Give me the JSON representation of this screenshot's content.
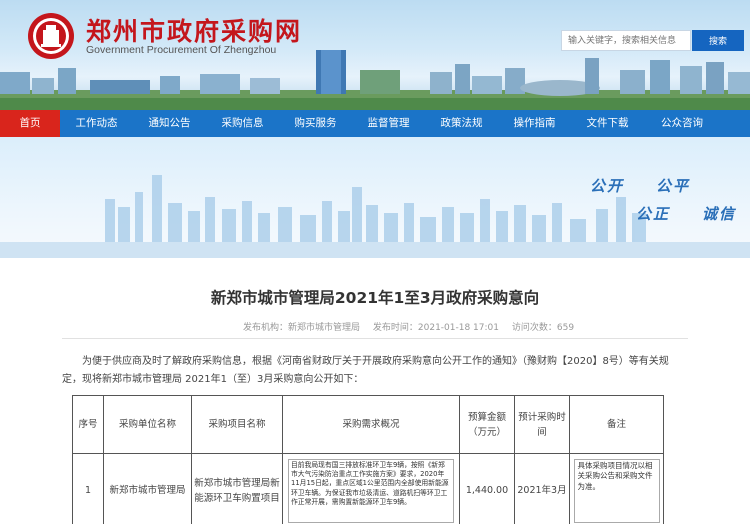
{
  "header": {
    "site_title": "郑州市政府采购网",
    "site_subtitle": "Government Procurement Of Zhengzhou",
    "search_placeholder": "输入关键字，搜索相关信息",
    "search_button": "搜索",
    "brand_color": "#c4161c"
  },
  "nav": {
    "items": [
      {
        "label": "首页",
        "active": true
      },
      {
        "label": "工作动态"
      },
      {
        "label": "通知公告"
      },
      {
        "label": "采购信息"
      },
      {
        "label": "购买服务"
      },
      {
        "label": "监督管理"
      },
      {
        "label": "政策法规"
      },
      {
        "label": "操作指南"
      },
      {
        "label": "文件下载"
      },
      {
        "label": "公众咨询"
      }
    ],
    "bg_color": "#1b74c8",
    "active_color": "#d9251c"
  },
  "banner": {
    "slogans": [
      "公开",
      "公平",
      "公正",
      "诚信"
    ]
  },
  "article": {
    "title": "新郑市城市管理局2021年1至3月政府采购意向",
    "meta": {
      "publisher": "发布机构：新郑市城市管理局",
      "publish_time": "发布时间：2021-01-18 17:01",
      "views": "访问次数：659"
    },
    "intro": "为便于供应商及时了解政府采购信息，根据《河南省财政厅关于开展政府采购意向公开工作的通知》（豫财购【2020】8号）等有关规定，现将新郑市城市管理局 2021年1（至）3月采购意向公开如下：",
    "table": {
      "headers": [
        "序号",
        "采购单位名称",
        "采购项目名称",
        "采购需求概况",
        "预算金额（万元）",
        "预计采购时间",
        "备注"
      ],
      "rows": [
        {
          "index": "1",
          "unit": "新郑市城市管理局",
          "project": "新郑市城市管理局新能源环卫车购置项目",
          "description": "目前我局现有国三排放标准环卫车9辆，按照《新郑市大气污染防治重点工作实施方案》要求，2020年11月15日起，重点区域1公里范围内全部使用新能源环卫车辆。为保证我市垃圾清运、道路机扫等环卫工作正常开展，需购置新能源环卫车9辆。",
          "budget": "1,440.00",
          "time": "2021年3月",
          "note": "具体采购项目情况以相关采购公告和采购文件为准。"
        }
      ]
    }
  }
}
